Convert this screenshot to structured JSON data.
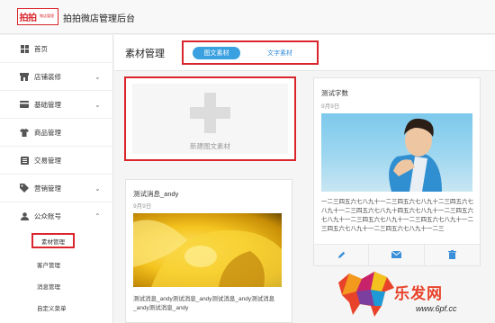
{
  "header": {
    "logo_text": "拍拍",
    "logo_sub": "微店管理",
    "app_title": "拍拍微店管理后台"
  },
  "sidebar": {
    "items": [
      {
        "label": "首页",
        "icon": "grid-icon"
      },
      {
        "label": "店铺装修",
        "icon": "store-icon"
      },
      {
        "label": "基础管理",
        "icon": "card-icon"
      },
      {
        "label": "商品管理",
        "icon": "shirt-icon"
      },
      {
        "label": "交易管理",
        "icon": "list-icon"
      },
      {
        "label": "营销管理",
        "icon": "tag-icon"
      },
      {
        "label": "公众账号",
        "icon": "user-icon"
      }
    ],
    "subitems": [
      {
        "label": "素材管理",
        "active": true
      },
      {
        "label": "客户管理"
      },
      {
        "label": "消息管理"
      },
      {
        "label": "自定义菜单"
      }
    ]
  },
  "main": {
    "page_title": "素材管理",
    "tabs": [
      {
        "label": "图文素材",
        "active": true
      },
      {
        "label": "文字素材"
      }
    ],
    "new_material_label": "新建图文素材",
    "cards": [
      {
        "title": "测试字数",
        "date": "9月9日",
        "body": "一二三四五六七八九十一二三四五六七八九十二三四五六七八九十一二三四五六七八九十四五六七八九十一二三四五六七八九十一二三四五六七八九十一二三四五六七八九十一二三四五六七八九十一二三四五六七八九十一二三"
      },
      {
        "title": "测试消息_andy",
        "date": "9月9日",
        "body": "测试消息_andy测试消息_andy测试消息_andy测试消息_andy测试消息_andy"
      }
    ]
  },
  "watermark": {
    "text": "乐发网",
    "url": "www.6pf.cc"
  },
  "colors": {
    "accent_red": "#d9262c",
    "tab_blue": "#3aa1e0",
    "icon_blue": "#3a8fd8"
  }
}
